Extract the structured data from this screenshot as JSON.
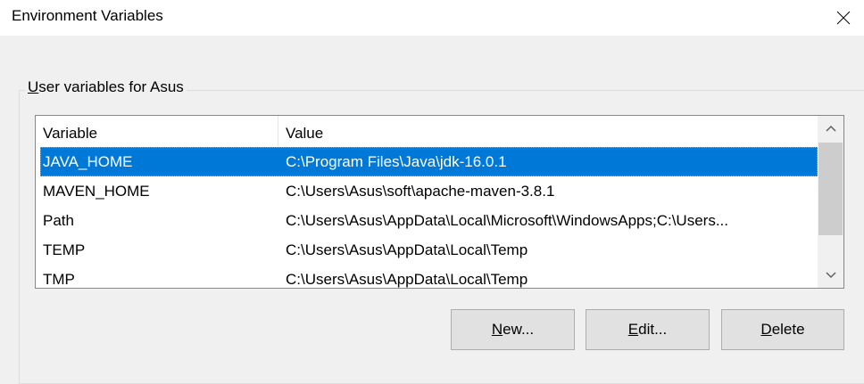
{
  "window": {
    "title": "Environment Variables",
    "close_icon": "close-icon"
  },
  "user_vars": {
    "group_label_prefix": "U",
    "group_label_rest": "ser variables for Asus",
    "columns": {
      "variable": "Variable",
      "value": "Value"
    },
    "rows": [
      {
        "variable": "JAVA_HOME",
        "value": "C:\\Program Files\\Java\\jdk-16.0.1",
        "selected": true
      },
      {
        "variable": "MAVEN_HOME",
        "value": "C:\\Users\\Asus\\soft\\apache-maven-3.8.1",
        "selected": false
      },
      {
        "variable": "Path",
        "value": "C:\\Users\\Asus\\AppData\\Local\\Microsoft\\WindowsApps;C:\\Users...",
        "selected": false
      },
      {
        "variable": "TEMP",
        "value": "C:\\Users\\Asus\\AppData\\Local\\Temp",
        "selected": false
      },
      {
        "variable": "TMP",
        "value": "C:\\Users\\Asus\\AppData\\Local\\Temp",
        "selected": false
      }
    ],
    "buttons": {
      "new_mnemonic": "N",
      "new_rest": "ew...",
      "edit_mnemonic": "E",
      "edit_rest": "dit...",
      "delete_mnemonic": "D",
      "delete_rest": "elete"
    }
  },
  "colors": {
    "selection": "#0078d7",
    "background": "#f0f0f0",
    "button": "#e1e1e1"
  }
}
